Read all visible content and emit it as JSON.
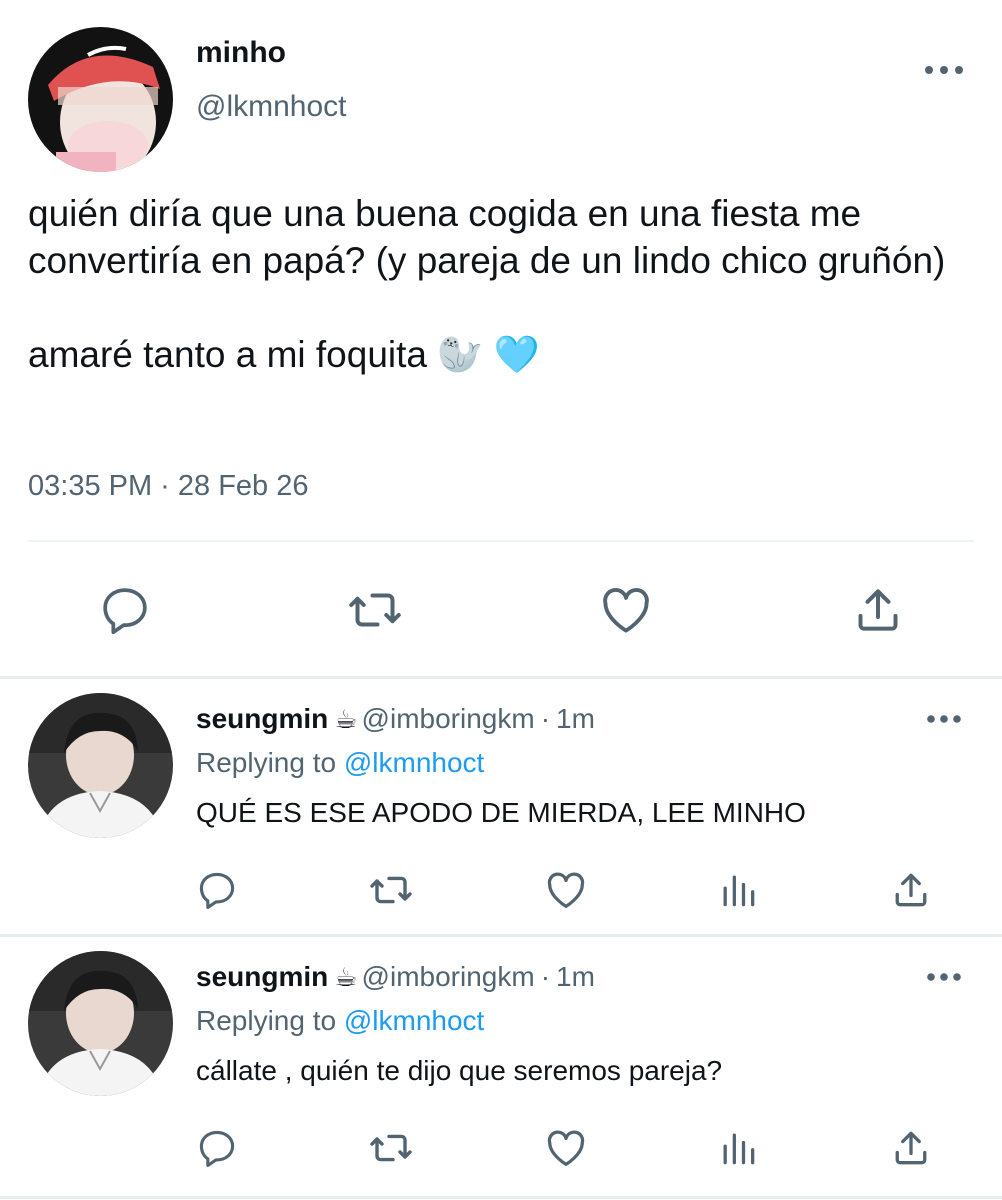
{
  "main_tweet": {
    "author_name": "minho",
    "author_handle": "@lkmnhoct",
    "text_line1": "quién diría que una buena cogida en una fiesta me convertiría en papá? (y pareja de un lindo chico gruñón)",
    "text_line2": "amaré tanto a mi foquita 🦭 🩵",
    "timestamp": "03:35 PM · 28 Feb 26",
    "actions": [
      "reply-icon",
      "retweet-icon",
      "like-icon",
      "share-icon"
    ]
  },
  "replies": [
    {
      "author_name": "seungmin",
      "author_emoji": "☕",
      "author_handle": "@imboringkm",
      "separator": "·",
      "time": "1m",
      "replying_prefix": "Replying to",
      "replying_to": "@lkmnhoct",
      "text": "QUÉ ES ESE APODO DE MIERDA, LEE MINHO"
    },
    {
      "author_name": "seungmin",
      "author_emoji": "☕",
      "author_handle": "@imboringkm",
      "separator": "·",
      "time": "1m",
      "replying_prefix": "Replying to",
      "replying_to": "@lkmnhoct",
      "text": "cállate , quién te dijo que seremos pareja?"
    }
  ],
  "colors": {
    "text_primary": "#0f1419",
    "text_secondary": "#536471",
    "link": "#1d9bf0",
    "divider": "#eff3f4",
    "icon": "#536471"
  }
}
